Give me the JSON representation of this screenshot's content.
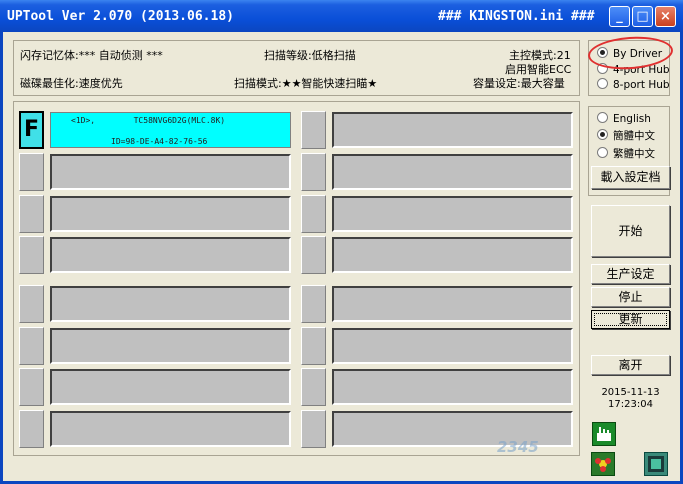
{
  "window": {
    "title_left": "UPTool Ver 2.070 (2013.06.18)",
    "title_right": "### KINGSTON.ini ###",
    "minimize": "_",
    "maximize": "□",
    "close": "×"
  },
  "info": {
    "flash_memory": "闪存记忆体:*** 自动侦测 ***",
    "scan_level": "扫描等级:低格扫描",
    "controller_mode": "主控模式:21",
    "enable_ecc": "启用智能ECC",
    "disk_optimize": "磁碟最佳化:速度优先",
    "scan_mode": "扫描模式:★★智能快速扫瞄★",
    "capacity_setting": "容量设定:最大容量"
  },
  "slots": {
    "active_letter": "F",
    "active_line1": "<1D>,        TC58NVG6D2G(MLC.8K)",
    "active_line2": "ID=98-DE-A4-82-76-56"
  },
  "mode_options": [
    {
      "label": "By Driver",
      "selected": true
    },
    {
      "label": "4-port Hub",
      "selected": false
    },
    {
      "label": "8-port Hub",
      "selected": false
    }
  ],
  "language_options": [
    {
      "label": "English",
      "selected": false
    },
    {
      "label": "簡體中文",
      "selected": true
    },
    {
      "label": "繁體中文",
      "selected": false
    }
  ],
  "buttons": {
    "load_settings": "載入設定档",
    "start": "开始",
    "production_settings": "生产设定",
    "stop": "停止",
    "update": "更新",
    "exit": "离开"
  },
  "status": {
    "date": "2015-11-13",
    "time": "17:23:04"
  },
  "colors": {
    "titlebar": "#0a4fd8",
    "active_slot": "#00ffff",
    "annotation": "#e03030"
  }
}
